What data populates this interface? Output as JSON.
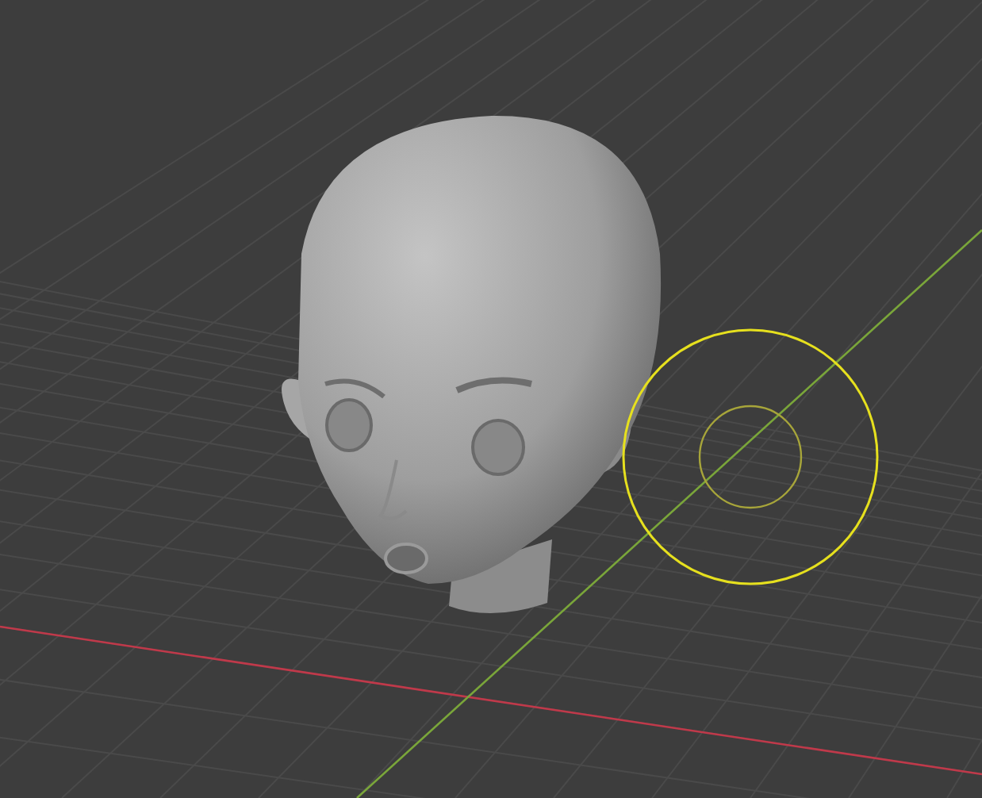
{
  "viewport": {
    "show_grid": true,
    "show_axes": true,
    "brush_cursor": true
  }
}
